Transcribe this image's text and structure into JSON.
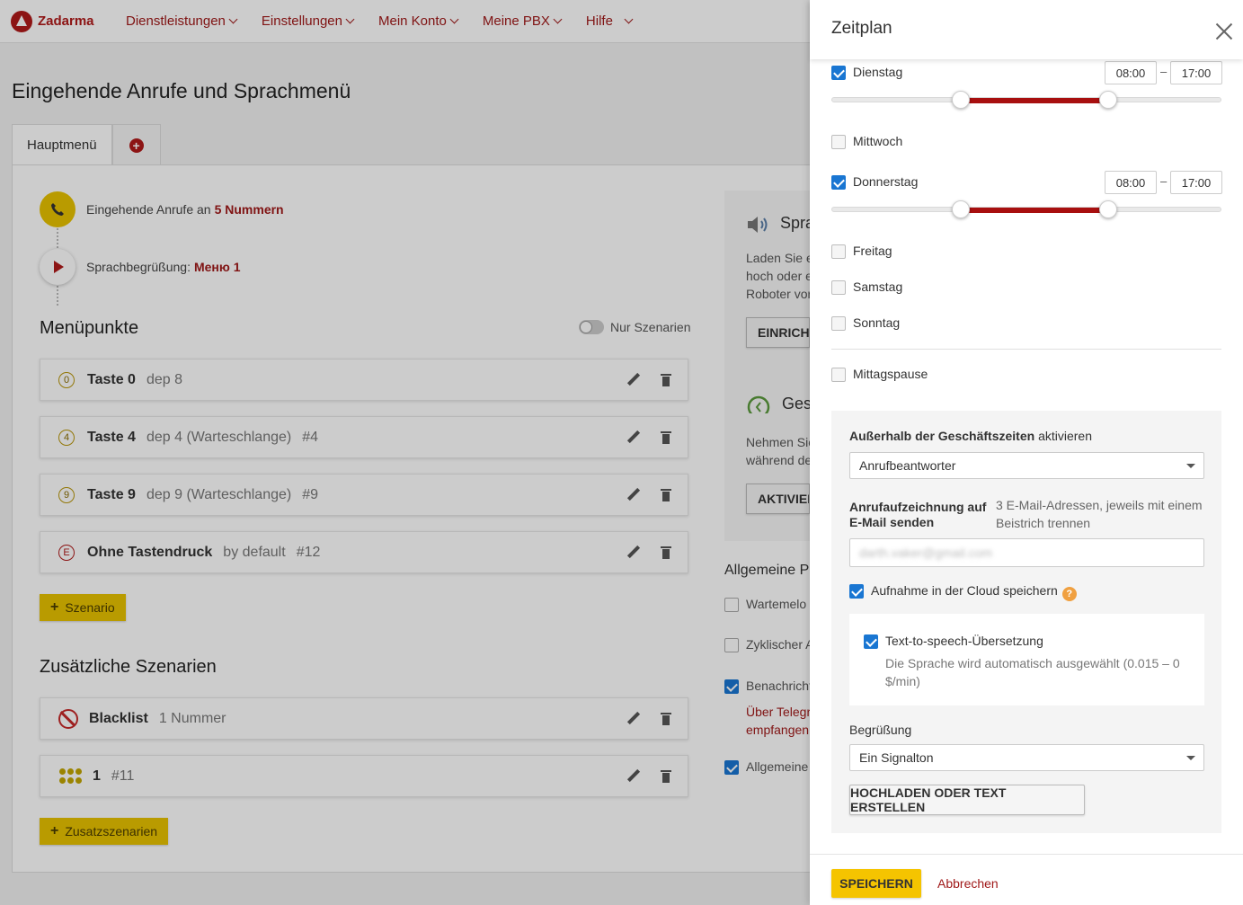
{
  "app": {
    "logo": "Zadarma",
    "nav": [
      "Dienstleistungen",
      "Einstellungen",
      "Mein Konto",
      "Meine PBX",
      "Hilfe"
    ]
  },
  "page": {
    "title": "Eingehende Anrufe und Sprachmenü",
    "tab_main": "Hauptmenü",
    "flow": {
      "incoming_prefix": "Eingehende Anrufe an",
      "incoming_link": "5 Nummern",
      "greeting_prefix": "Sprachbegrüßung:",
      "greeting_link": "Меню 1"
    },
    "menu_title": "Menüpunkte",
    "only_scenarios": "Nur Szenarien",
    "menu_items": [
      {
        "key": "0",
        "name": "Taste 0",
        "sub": "dep 8",
        "id": ""
      },
      {
        "key": "4",
        "name": "Taste 4",
        "sub": "dep 4 (Warteschlange)",
        "id": "#4"
      },
      {
        "key": "9",
        "name": "Taste 9",
        "sub": "dep 9 (Warteschlange)",
        "id": "#9"
      },
      {
        "key": "E",
        "name": "Ohne Tastendruck",
        "sub": "by default",
        "id": "#12"
      }
    ],
    "add_scenario": "Szenario",
    "extra_title": "Zusätzliche Szenarien",
    "extra_items": [
      {
        "name": "Blacklist",
        "sub": "1 Nummer",
        "id": ""
      },
      {
        "name": "1",
        "sub": "",
        "id": "#11"
      }
    ],
    "add_extra": "Zusatzszenarien",
    "side": {
      "speech_title": "Spra",
      "speech_lines": [
        "Laden Sie e",
        "hoch oder e",
        "Roboter vor"
      ],
      "speech_btn": "EINRICHT",
      "biz_title": "Ges",
      "biz_lines": [
        "Nehmen Sie",
        "während de"
      ],
      "biz_btn": "AKTIVIER",
      "general_title": "Allgemeine P",
      "general_items": [
        "Wartemelo",
        "Zyklischer A",
        "Benachricht",
        "Allgemeine"
      ],
      "general_sub": [
        "Über Telegr",
        "empfangen"
      ]
    }
  },
  "drawer": {
    "title": "Zeitplan",
    "days": {
      "tuesday": {
        "label": "Dienstag",
        "from": "08:00",
        "to": "17:00",
        "range": [
          0.33,
          0.707
        ]
      },
      "wednesday": {
        "label": "Mittwoch"
      },
      "thursday": {
        "label": "Donnerstag",
        "from": "08:00",
        "to": "17:00",
        "range": [
          0.33,
          0.707
        ]
      },
      "friday": {
        "label": "Freitag"
      },
      "saturday": {
        "label": "Samstag"
      },
      "sunday": {
        "label": "Sonntag"
      }
    },
    "dash": "–",
    "lunch": "Mittagspause",
    "outside_bold": "Außerhalb der Geschäftszeiten",
    "outside_rest": "aktivieren",
    "outside_value": "Anrufbeantworter",
    "email_label": "Anrufaufzeichnung auf E-Mail senden",
    "email_hint": "3 E-Mail-Adressen, jeweils mit einem Beistrich trennen",
    "email_value": "darth.vaker@gmail.com",
    "cloud_label": "Aufnahme in der Cloud speichern",
    "help": "?",
    "tts_label": "Text-to-speech-Übersetzung",
    "tts_hint": "Die Sprache wird automatisch ausgewählt (0.015 – 0 $/min)",
    "greeting_label": "Begrüßung",
    "greeting_value": "Ein Signalton",
    "upload_btn": "HOCHLADEN ODER TEXT ERSTELLEN",
    "save_btn": "SPEICHERN",
    "cancel_btn": "Abbrechen"
  },
  "colors": {
    "accent": "#a01919",
    "yellow": "#e8c200",
    "check": "#1976d2",
    "range": "#a80f0f"
  }
}
